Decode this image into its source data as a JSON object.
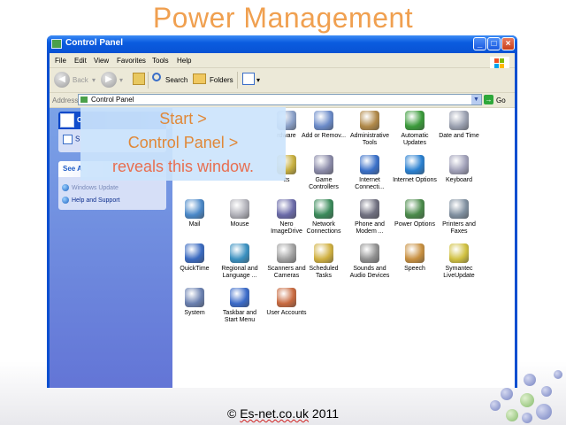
{
  "slide": {
    "title": "Power Management",
    "footer_prefix": "© ",
    "footer_site": "Es-net.co.uk",
    "footer_year": " 2011"
  },
  "window": {
    "title": "Control Panel",
    "buttons": {
      "minimize": "_",
      "maximize": "□",
      "close": "×"
    }
  },
  "menubar": [
    "File",
    "Edit",
    "View",
    "Favorites",
    "Tools",
    "Help"
  ],
  "toolbar": {
    "back_label": "Back",
    "search_label": "Search",
    "folders_label": "Folders"
  },
  "address": {
    "label": "Address",
    "value": "Control Panel",
    "go_label": "Go"
  },
  "left_pane": {
    "panel1_title": "C",
    "panel1_row": "S",
    "panel2_title": "See A",
    "links": [
      "Windows Update",
      "Help and Support"
    ]
  },
  "callout": {
    "line1": "Start >",
    "line2": "Control Panel >",
    "line3": "reveals this window."
  },
  "items": [
    {
      "label": "rdware",
      "icon": "hardware-icon",
      "color": "#8aa0c8"
    },
    {
      "label": "Add or Remov...",
      "icon": "add-remove-programs-icon",
      "color": "#6a8ac8"
    },
    {
      "label": "Administrative Tools",
      "icon": "administrative-tools-icon",
      "color": "#b08848"
    },
    {
      "label": "Automatic Updates",
      "icon": "automatic-updates-icon",
      "color": "#3a9a3a"
    },
    {
      "label": "Date and Time",
      "icon": "date-time-icon",
      "color": "#9aa0b0"
    },
    {
      "label": "its",
      "icon": "fonts-icon",
      "color": "#c8b040"
    },
    {
      "label": "Game Controllers",
      "icon": "game-controllers-icon",
      "color": "#8a8aa8"
    },
    {
      "label": "Internet Connecti...",
      "icon": "internet-connection-icon",
      "color": "#3a70c8"
    },
    {
      "label": "Internet Options",
      "icon": "internet-options-icon",
      "color": "#2a80d0"
    },
    {
      "label": "Keyboard",
      "icon": "keyboard-icon",
      "color": "#a0a0b8"
    },
    {
      "label": "Mail",
      "icon": "mail-icon",
      "color": "#4a88c8"
    },
    {
      "label": "Mouse",
      "icon": "mouse-icon",
      "color": "#b0b0b8"
    },
    {
      "label": "Nero ImageDrive",
      "icon": "nero-imagedrive-icon",
      "color": "#6a6aa8"
    },
    {
      "label": "Network Connections",
      "icon": "network-connections-icon",
      "color": "#3a8a5a"
    },
    {
      "label": "Phone and Modem ...",
      "icon": "phone-modem-icon",
      "color": "#707080"
    },
    {
      "label": "Power Options",
      "icon": "power-options-icon",
      "color": "#4a8a4a"
    },
    {
      "label": "Printers and Faxes",
      "icon": "printers-faxes-icon",
      "color": "#8090a0"
    },
    {
      "label": "QuickTime",
      "icon": "quicktime-icon",
      "color": "#3a6ac0"
    },
    {
      "label": "Regional and Language ...",
      "icon": "regional-language-icon",
      "color": "#3a90c0"
    },
    {
      "label": "Scanners and Cameras",
      "icon": "scanners-cameras-icon",
      "color": "#a0a0a0"
    },
    {
      "label": "Scheduled Tasks",
      "icon": "scheduled-tasks-icon",
      "color": "#d0b040"
    },
    {
      "label": "Sounds and Audio Devices",
      "icon": "sounds-audio-icon",
      "color": "#909090"
    },
    {
      "label": "Speech",
      "icon": "speech-icon",
      "color": "#c89040"
    },
    {
      "label": "Symantec LiveUpdate",
      "icon": "symantec-liveupdate-icon",
      "color": "#d0c040"
    },
    {
      "label": "System",
      "icon": "system-icon",
      "color": "#6a80b0"
    },
    {
      "label": "Taskbar and Start Menu",
      "icon": "taskbar-start-menu-icon",
      "color": "#3a6ac8"
    },
    {
      "label": "User Accounts",
      "icon": "user-accounts-icon",
      "color": "#c86a40"
    }
  ]
}
